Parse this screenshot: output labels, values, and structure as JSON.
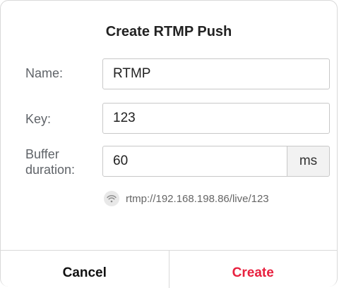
{
  "dialog": {
    "title": "Create RTMP Push",
    "name_label": "Name:",
    "name_value": "RTMP",
    "key_label": "Key:",
    "key_value": "123",
    "buffer_label_line1": "Buffer",
    "buffer_label_line2": "duration:",
    "buffer_value": "60",
    "buffer_unit": "ms",
    "url": "rtmp://192.168.198.86/live/123",
    "url_icon": "wifi-icon"
  },
  "footer": {
    "cancel_label": "Cancel",
    "create_label": "Create"
  },
  "colors": {
    "accent": "#e8213f",
    "border": "#c8c8c8"
  }
}
